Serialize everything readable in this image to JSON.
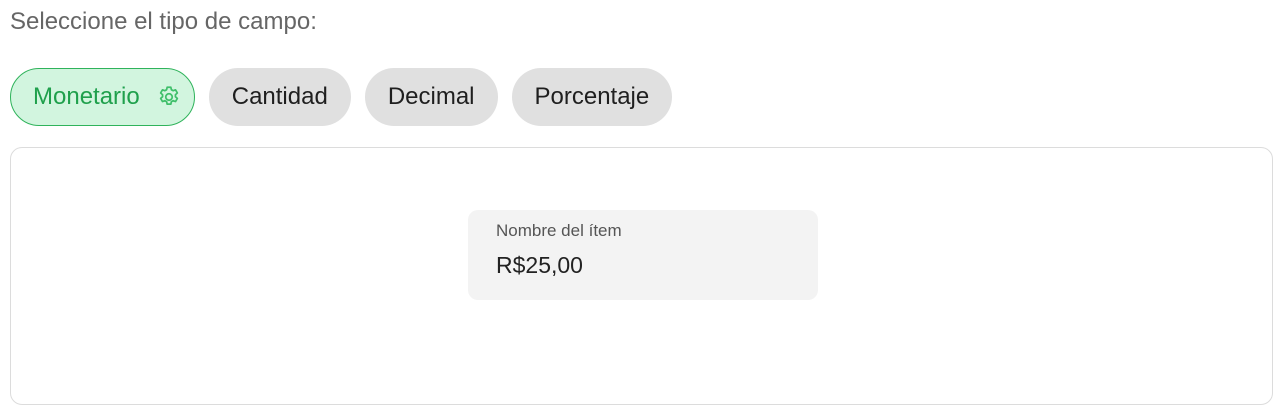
{
  "prompt": "Seleccione el tipo de campo:",
  "chips": [
    {
      "label": "Monetario",
      "selected": true,
      "icon": "gear-icon"
    },
    {
      "label": "Cantidad",
      "selected": false
    },
    {
      "label": "Decimal",
      "selected": false
    },
    {
      "label": "Porcentaje",
      "selected": false
    }
  ],
  "preview": {
    "label": "Nombre del ítem",
    "value": "R$25,00"
  },
  "colors": {
    "accent": "#1fa04c",
    "accent_bg": "#d2f5df",
    "chip_bg": "#e0e0e0"
  }
}
